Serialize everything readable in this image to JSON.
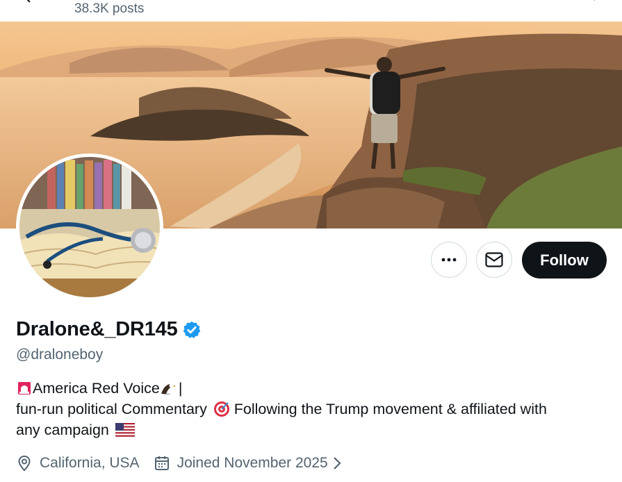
{
  "header": {
    "posts_count": "38.3K posts",
    "back_icon": "back-arrow-icon",
    "right_icons": [
      "search-icon"
    ]
  },
  "banner": {
    "description_icon": "banner-image"
  },
  "avatar": {
    "icon": "avatar-image"
  },
  "actions": {
    "more_icon": "more-icon",
    "message_icon": "envelope-icon",
    "follow_label": "Follow"
  },
  "profile": {
    "display_name": "Dralone&_DR145",
    "verified_icon": "verified-badge-icon",
    "handle": "@draloneboy",
    "bio": {
      "line1_text": "America Red Voice",
      "line1_suffix": "|",
      "line2_text_a": "fun-run political Commentary ",
      "line2_text_b": " Following the Trump movement & affiliated with",
      "line3_text": "any campaign ",
      "emoji": [
        "siren-emoji",
        "eagle-emoji",
        "target-emoji",
        "us-flag-emoji"
      ]
    },
    "location": "California, USA",
    "joined": "Joined November 2025"
  },
  "colors": {
    "text": "#0f1419",
    "muted": "#536471",
    "verified": "#1d9bf0",
    "follow_bg": "#0f1419",
    "border": "#cfd9de"
  }
}
